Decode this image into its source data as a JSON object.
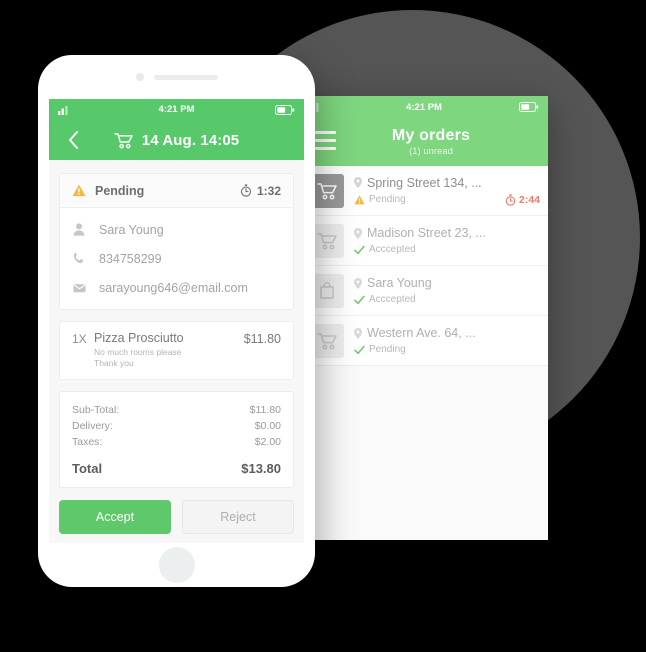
{
  "theme": {
    "green_front": "#58c96a",
    "green_back": "#7ed67e",
    "accept_green": "#5ec86a",
    "warning_amber": "#f5b843",
    "timer_red": "#ef7b6e",
    "check_green": "#6dc96d",
    "backdrop_gray": "#555556",
    "page_background": "#000000"
  },
  "front_phone": {
    "status_bar": {
      "time": "4:21 PM",
      "signal_icon": "signal-bars-icon",
      "battery_icon": "battery-icon"
    },
    "header": {
      "back_icon": "back-chevron-icon",
      "cart_icon": "shopping-cart-icon",
      "title": "14 Aug. 14:05"
    },
    "status_card": {
      "warning_icon": "warning-triangle-icon",
      "status": "Pending",
      "timer_icon": "stopwatch-icon",
      "timer": "1:32"
    },
    "contact": [
      {
        "icon": "person-icon",
        "value": "Sara Young"
      },
      {
        "icon": "phone-icon",
        "value": "834758299"
      },
      {
        "icon": "envelope-icon",
        "value": "sarayoung646@email.com"
      }
    ],
    "items": [
      {
        "qty": "1X",
        "name": "Pizza Prosciutto",
        "note_line1": "No much rooms please",
        "note_line2": "Thank you",
        "price": "$11.80"
      }
    ],
    "totals": {
      "lines": [
        {
          "label": "Sub-Total:",
          "value": "$11.80"
        },
        {
          "label": "Delivery:",
          "value": "$0.00"
        },
        {
          "label": "Taxes:",
          "value": "$2.00"
        }
      ],
      "grand_label": "Total",
      "grand_value": "$13.80"
    },
    "actions": {
      "accept_label": "Accept",
      "reject_label": "Reject"
    }
  },
  "back_phone": {
    "status_bar": {
      "time": "4:21 PM",
      "signal_icon": "signal-bars-icon",
      "battery_icon": "battery-icon"
    },
    "header": {
      "menu_icon": "hamburger-menu-icon",
      "title": "My orders",
      "subtitle": "(1) unread"
    },
    "orders": [
      {
        "thumb_icon": "shopping-cart-icon",
        "thumb_variant": "dark",
        "pin_icon": "location-pin-icon",
        "address": "Spring Street 134, ...",
        "status_icon": "warning-triangle-icon",
        "status": "Pending",
        "timer_icon": "stopwatch-icon",
        "timer": "2:44"
      },
      {
        "thumb_icon": "shopping-cart-icon",
        "thumb_variant": "light",
        "pin_icon": "location-pin-icon",
        "address": "Madison Street 23, ...",
        "status_icon": "check-icon",
        "status": "Acccepted",
        "timer_icon": "",
        "timer": ""
      },
      {
        "thumb_icon": "shopping-bag-icon",
        "thumb_variant": "light",
        "pin_icon": "location-pin-icon",
        "address": "Sara Young",
        "status_icon": "check-icon",
        "status": "Acccepted",
        "timer_icon": "",
        "timer": ""
      },
      {
        "thumb_icon": "shopping-cart-icon",
        "thumb_variant": "light",
        "pin_icon": "location-pin-icon",
        "address": "Western Ave. 64, ...",
        "status_icon": "check-icon",
        "status": "Pending",
        "timer_icon": "",
        "timer": ""
      }
    ]
  }
}
